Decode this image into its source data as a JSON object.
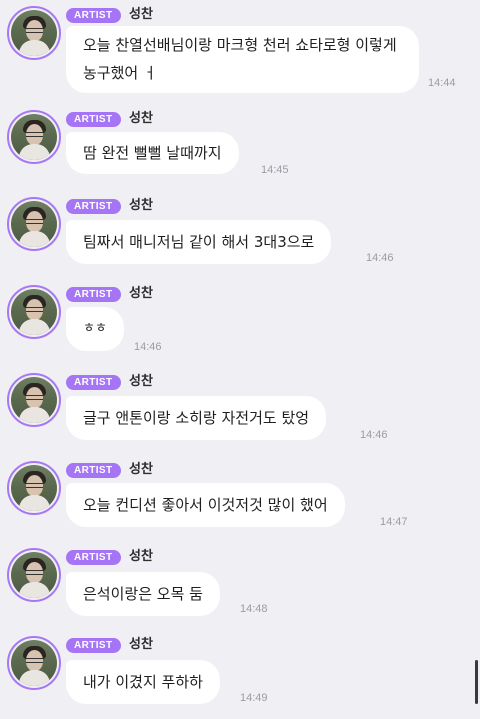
{
  "badge_label": "ARTIST",
  "sender": "성찬",
  "colors": {
    "background": "#f0eff3",
    "badge": "#a575f5",
    "avatar_ring": "#a778f5",
    "bubble": "#ffffff",
    "timestamp": "#9c9ca3"
  },
  "messages": [
    {
      "text": "오늘 찬열선배님이랑 마크형 천러 쇼타로형 이렇게 농구했어 ㅓ",
      "time": "14:44"
    },
    {
      "text": "땀 완전 뻘뻘 날때까지",
      "time": "14:45"
    },
    {
      "text": "팀짜서 매니저님 같이 해서 3대3으로",
      "time": "14:46"
    },
    {
      "text": "ㅎㅎ",
      "time": "14:46"
    },
    {
      "text": "글구 앤톤이랑 소히랑 자전거도 탔엉",
      "time": "14:46"
    },
    {
      "text": "오늘 컨디션 좋아서 이것저것 많이 했어",
      "time": "14:47"
    },
    {
      "text": "은석이랑은 오목 둠",
      "time": "14:48"
    },
    {
      "text": "내가 이겼지 푸하하",
      "time": "14:49"
    }
  ]
}
